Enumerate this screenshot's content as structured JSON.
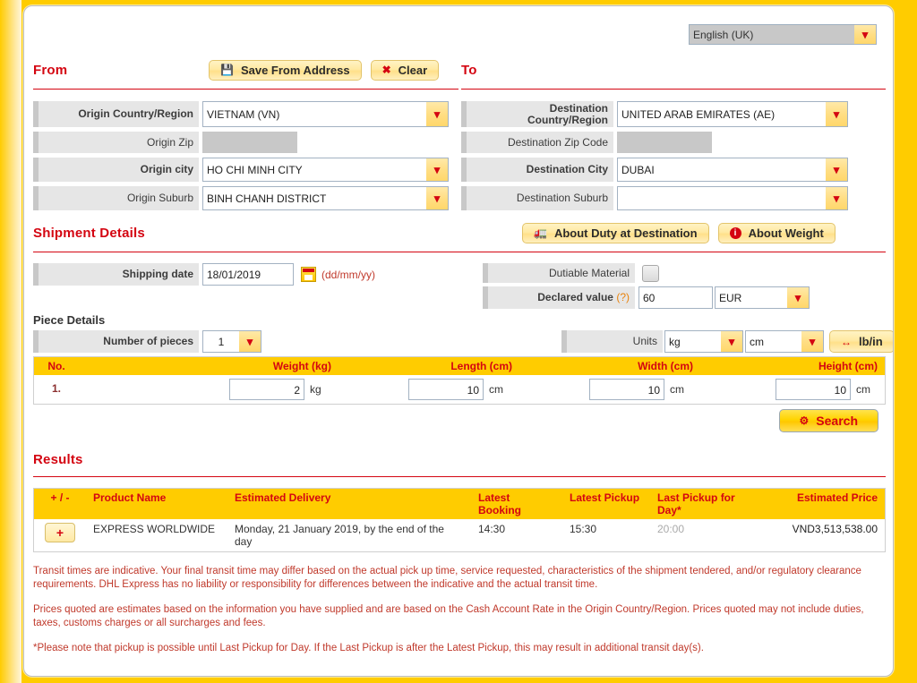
{
  "language": {
    "label": "English (UK)",
    "icon": "chevron-down-icon"
  },
  "from": {
    "title": "From",
    "save_button": "Save From Address",
    "save_icon": "save-disk-icon",
    "clear_button": "Clear",
    "clear_icon": "close-x-icon",
    "fields": [
      {
        "label": "Origin Country/Region",
        "value": "VIETNAM (VN)",
        "type": "select",
        "bold": true
      },
      {
        "label": "Origin Zip",
        "value": "",
        "type": "disabled",
        "bold": false
      },
      {
        "label": "Origin city",
        "value": "HO CHI MINH CITY",
        "type": "select",
        "bold": true
      },
      {
        "label": "Origin Suburb",
        "value": "BINH CHANH DISTRICT",
        "type": "select",
        "bold": false
      }
    ]
  },
  "to": {
    "title": "To",
    "fields": [
      {
        "label": "Destination Country/Region",
        "value": "UNITED ARAB EMIRATES (AE)",
        "type": "select",
        "bold": true
      },
      {
        "label": "Destination Zip Code",
        "value": "",
        "type": "disabled",
        "bold": false
      },
      {
        "label": "Destination City",
        "value": "DUBAI",
        "type": "select",
        "bold": true
      },
      {
        "label": "Destination Suburb",
        "value": "",
        "type": "select",
        "bold": false
      }
    ]
  },
  "shipment": {
    "title": "Shipment Details",
    "duty_button": "About Duty at Destination",
    "duty_icon": "duty-truck-icon",
    "weight_button": "About Weight",
    "weight_icon": "info-icon",
    "shipping_date_label": "Shipping date",
    "shipping_date_value": "18/01/2019",
    "calendar_icon": "calendar-icon",
    "date_format_hint": "(dd/mm/yy)",
    "dutiable_label": "Dutiable Material",
    "dutiable_checked": false,
    "declared_label": "Declared value",
    "declared_help": "(?)",
    "declared_value": "60",
    "declared_currency": "EUR"
  },
  "piece_details": {
    "title": "Piece Details",
    "pieces_label": "Number of pieces",
    "pieces_value": "1",
    "units_label": "Units",
    "units_weight": "kg",
    "units_length": "cm",
    "toggle_button": "lb/in",
    "toggle_icon": "swap-arrows-icon",
    "columns": [
      "No.",
      "Weight (kg)",
      "Length (cm)",
      "Width (cm)",
      "Height (cm)"
    ],
    "rows": [
      {
        "no": "1.",
        "weight": "2",
        "weight_unit": "kg",
        "length": "10",
        "length_unit": "cm",
        "width": "10",
        "width_unit": "cm",
        "height": "10",
        "height_unit": "cm"
      }
    ]
  },
  "search_button": {
    "label": "Search",
    "icon": "gear-icon"
  },
  "results": {
    "title": "Results",
    "columns": [
      "+ / -",
      "Product Name",
      "Estimated Delivery",
      "Latest Booking",
      "Latest Pickup",
      "Last Pickup for Day*",
      "Estimated Price"
    ],
    "rows": [
      {
        "expand": "+",
        "product": "EXPRESS WORLDWIDE",
        "delivery": "Monday, 21 January 2019, by the end of the day",
        "latest_booking": "14:30",
        "latest_pickup": "15:30",
        "last_pickup_day": "20:00",
        "price": "VND3,513,538.00"
      }
    ]
  },
  "footer": {
    "paragraphs": [
      "Transit times are indicative. Your final transit time may differ based on the actual pick up time, service requested, characteristics of the shipment tendered, and/or regulatory clearance requirements. DHL Express has no liability or responsibility for differences between the indicative and the actual transit time.",
      "Prices quoted are estimates based on the information you have supplied and are based on the Cash Account Rate in the Origin Country/Region. Prices quoted may not include duties, taxes, customs charges or all surcharges and fees.",
      "*Please note that pickup is possible until Last Pickup for Day. If the Last Pickup is after the Latest Pickup, this may result in additional transit day(s)."
    ]
  },
  "colors": {
    "brand_yellow": "#FFCC00",
    "brand_red": "#D40511",
    "label_grey": "#E6E6E6"
  }
}
